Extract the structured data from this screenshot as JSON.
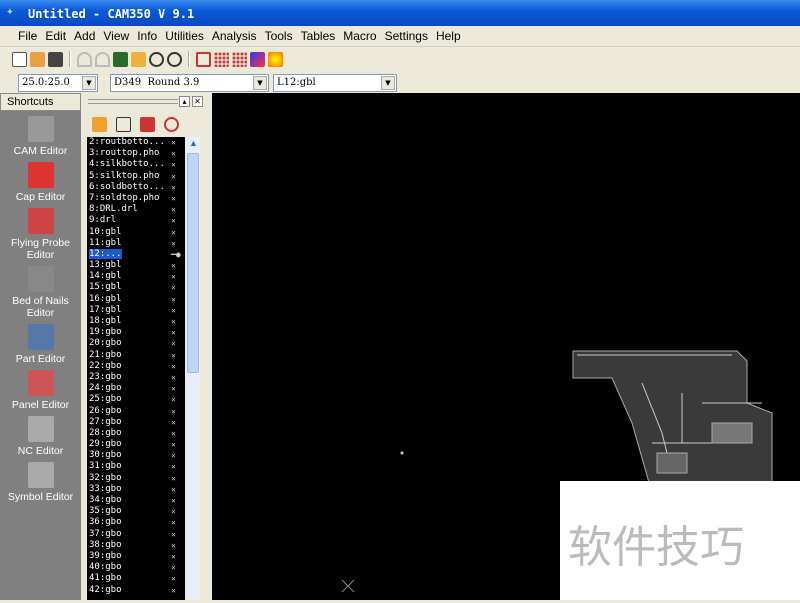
{
  "window": {
    "title": "Untitled - CAM350 V 9.1"
  },
  "menu": [
    "File",
    "Edit",
    "Add",
    "View",
    "Info",
    "Utilities",
    "Analysis",
    "Tools",
    "Tables",
    "Macro",
    "Settings",
    "Help"
  ],
  "combos": {
    "grid": "25.0:25.0",
    "aperture": "D349  Round 3.9",
    "layer": "L12:gbl"
  },
  "shortcuts": {
    "title": "Shortcuts",
    "items": [
      "CAM Editor",
      "Cap Editor",
      "Flying Probe Editor",
      "Bed of Nails Editor",
      "Part Editor",
      "Panel Editor",
      "NC Editor",
      "Symbol Editor"
    ]
  },
  "layers": [
    "2:routbotto...",
    "3:routtop.pho",
    "4:silkbotto...",
    "5:silktop.pho",
    "6:soldbotto...",
    "7:soldtop.pho",
    "8:DRL.drl",
    "9:drl",
    "10:gbl",
    "11:gbl",
    "12:...",
    "13:gbl",
    "14:gbl",
    "15:gbl",
    "16:gbl",
    "17:gbl",
    "18:gbl",
    "19:gbo",
    "20:gbo",
    "21:gbo",
    "22:gbo",
    "23:gbo",
    "24:gbo",
    "25:gbo",
    "26:gbo",
    "27:gbo",
    "28:gbo",
    "29:gbo",
    "30:gbo",
    "31:gbo",
    "32:gbo",
    "33:gbo",
    "34:gbo",
    "35:gbo",
    "36:gbo",
    "37:gbo",
    "38:gbo",
    "39:gbo",
    "40:gbo",
    "41:gbo",
    "42:gbo"
  ],
  "watermark": "软件技巧"
}
